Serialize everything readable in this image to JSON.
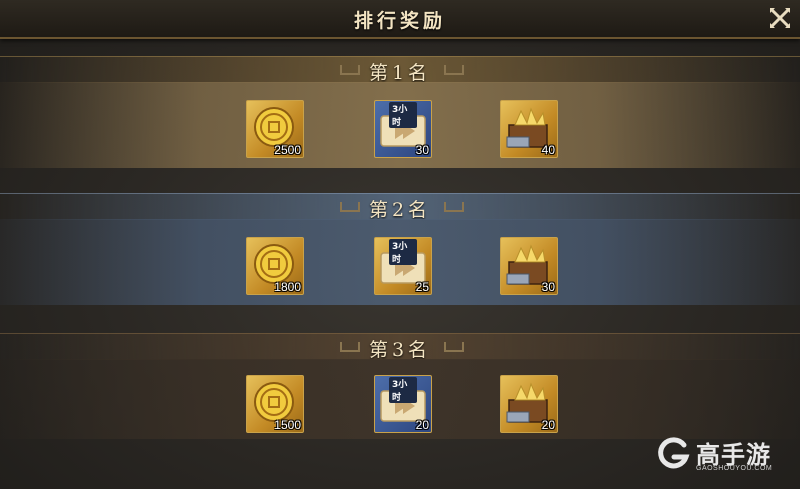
{
  "window": {
    "title": "排行奖励"
  },
  "ranks": [
    {
      "label": "第1名",
      "rewards": [
        {
          "icon": "gold-coin-icon",
          "count": "2500"
        },
        {
          "icon": "speedup-scroll-icon",
          "tag": "3小时",
          "count": "30"
        },
        {
          "icon": "treasure-chest-icon",
          "count": "40"
        }
      ]
    },
    {
      "label": "第2名",
      "rewards": [
        {
          "icon": "gold-coin-icon",
          "count": "1800"
        },
        {
          "icon": "speedup-scroll-icon",
          "tag": "3小时",
          "count": "25"
        },
        {
          "icon": "treasure-chest-icon",
          "count": "30"
        }
      ]
    },
    {
      "label": "第3名",
      "rewards": [
        {
          "icon": "gold-coin-icon",
          "count": "1500"
        },
        {
          "icon": "speedup-scroll-icon",
          "tag": "3小时",
          "count": "20"
        },
        {
          "icon": "treasure-chest-icon",
          "count": "20"
        }
      ]
    }
  ],
  "watermark": {
    "name": "高手游",
    "sub": "GAOSHOUYOU.COM"
  },
  "colors": {
    "gold_accent": "#c9a24a",
    "header_text": "#f3e4c2",
    "rank1_band": "#6e5a3a",
    "rank2_band": "#4e5f75",
    "rank3_band": "#3c3328"
  }
}
